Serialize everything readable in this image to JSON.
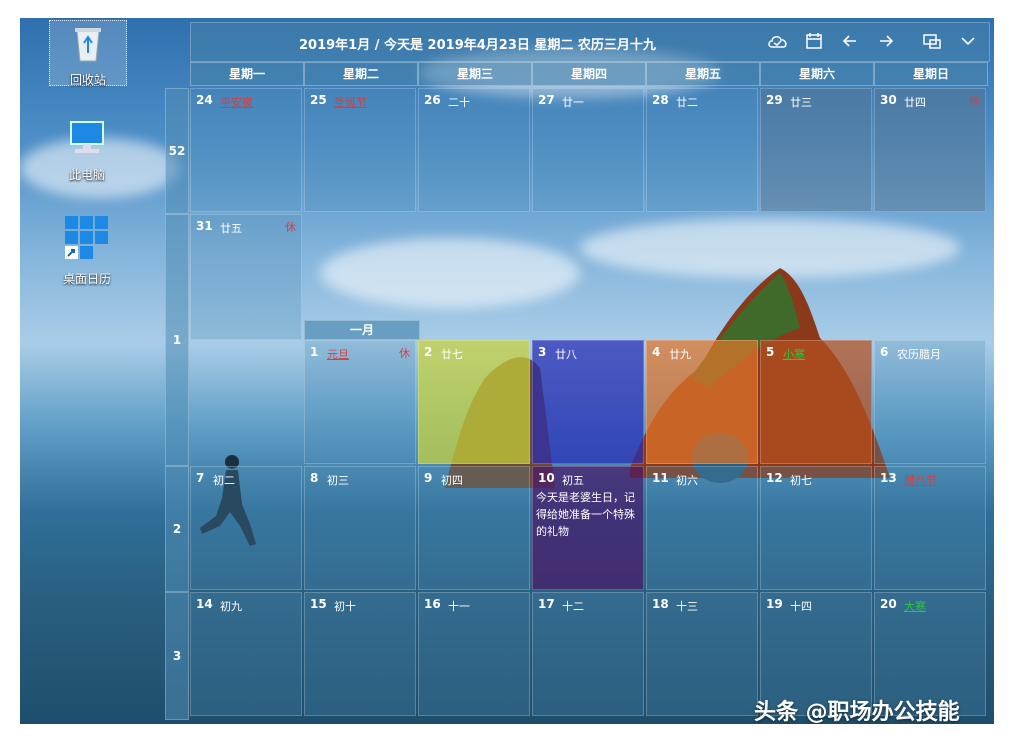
{
  "desktop": {
    "icons": [
      {
        "label": "回收站",
        "icon": "recycle-bin-icon"
      },
      {
        "label": "此电脑",
        "icon": "computer-icon"
      },
      {
        "label": "桌面日历",
        "icon": "calendar-app-icon"
      }
    ]
  },
  "calendar": {
    "title": "2019年1月 / 今天是 2019年4月23日 星期二 农历三月十九",
    "toolbar": {
      "sync_icon": "cloud-check-icon",
      "calendar_icon": "calendar-icon",
      "prev_icon": "arrow-left-icon",
      "next_icon": "arrow-right-icon",
      "window_icon": "window-switch-icon",
      "collapse_icon": "chevron-down-icon"
    },
    "weekdays": [
      "星期一",
      "星期二",
      "星期三",
      "星期四",
      "星期五",
      "星期六",
      "星期日"
    ],
    "week_numbers": [
      "52",
      "1",
      "2",
      "3"
    ],
    "month_label": "一月",
    "rest_mark": "休",
    "cells": [
      {
        "num": "24",
        "lunar": "平安夜",
        "style": "red-holiday"
      },
      {
        "num": "25",
        "lunar": "圣诞节",
        "style": "red-holiday"
      },
      {
        "num": "26",
        "lunar": "二十"
      },
      {
        "num": "27",
        "lunar": "廿一"
      },
      {
        "num": "28",
        "lunar": "廿二"
      },
      {
        "num": "29",
        "lunar": "廿三"
      },
      {
        "num": "30",
        "lunar": "廿四",
        "rest": true
      },
      {
        "num": "31",
        "lunar": "廿五",
        "rest": true
      },
      {
        "num": "1",
        "lunar": "元旦",
        "style": "red-holiday",
        "rest": true
      },
      {
        "num": "2",
        "lunar": "廿七"
      },
      {
        "num": "3",
        "lunar": "廿八"
      },
      {
        "num": "4",
        "lunar": "廿九"
      },
      {
        "num": "5",
        "lunar": "小寒",
        "style": "green-holiday"
      },
      {
        "num": "6",
        "lunar": "农历腊月"
      },
      {
        "num": "7",
        "lunar": "初二"
      },
      {
        "num": "8",
        "lunar": "初三"
      },
      {
        "num": "9",
        "lunar": "初四"
      },
      {
        "num": "10",
        "lunar": "初五",
        "note": "今天是老婆生日，记得给她准备一个特殊的礼物"
      },
      {
        "num": "11",
        "lunar": "初六"
      },
      {
        "num": "12",
        "lunar": "初七"
      },
      {
        "num": "13",
        "lunar": "腊八节",
        "style": "red-holiday"
      },
      {
        "num": "14",
        "lunar": "初九"
      },
      {
        "num": "15",
        "lunar": "初十"
      },
      {
        "num": "16",
        "lunar": "十一"
      },
      {
        "num": "17",
        "lunar": "十二"
      },
      {
        "num": "18",
        "lunar": "十三"
      },
      {
        "num": "19",
        "lunar": "十四"
      },
      {
        "num": "20",
        "lunar": "大寒",
        "style": "green-holiday"
      }
    ],
    "cell_colors": {
      "jan2": "#c8d23c",
      "jan3": "#2a2db4",
      "jan4": "#e0742a",
      "jan5": "#b45020",
      "jan10": "#4a1a6a"
    }
  },
  "watermark": "头条 @职场办公技能"
}
